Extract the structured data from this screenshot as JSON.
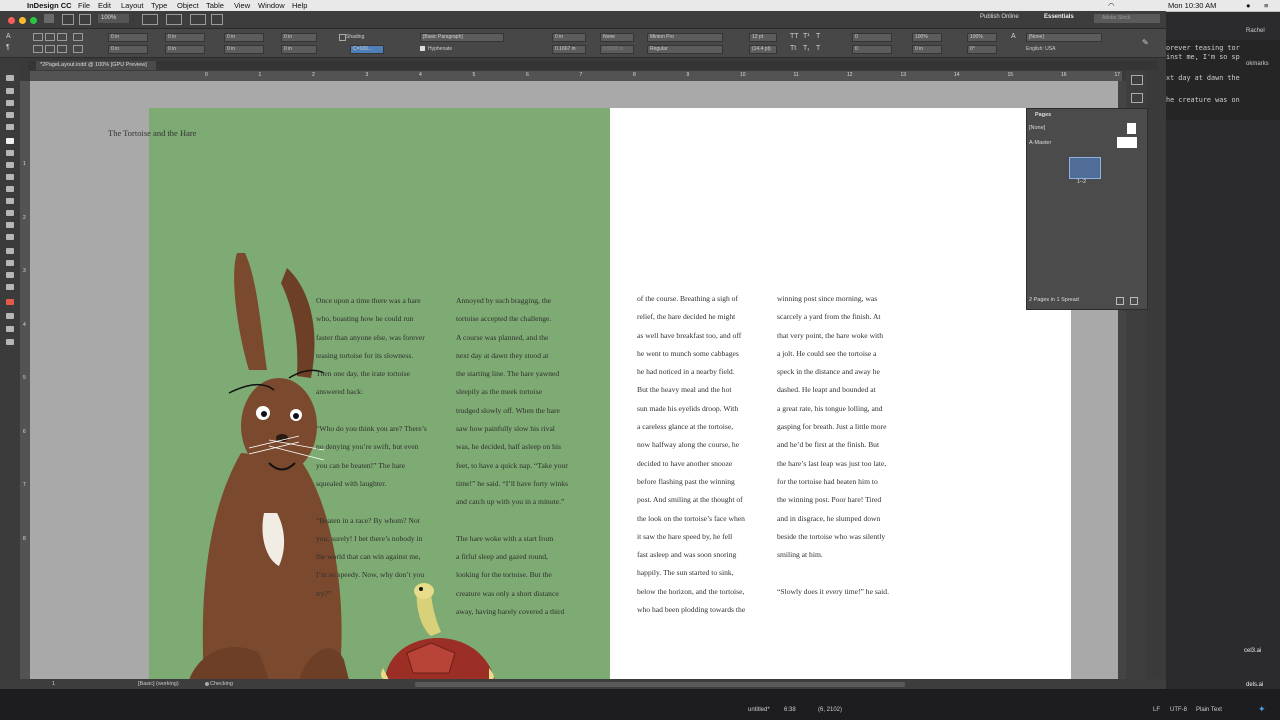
{
  "menubar": {
    "apple": "",
    "app_name": "InDesign CC",
    "items": [
      "File",
      "Edit",
      "Layout",
      "Type",
      "Object",
      "Table",
      "View",
      "Window",
      "Help"
    ],
    "clock": "Mon 10:30 AM",
    "user": "Rachel"
  },
  "titlebar": {
    "zoom": "100%",
    "publish": "Publish Online",
    "workspace": "Essentials",
    "search_placeholder": "Adobe Stock"
  },
  "control": {
    "fields_a": [
      "0 in",
      "0 in",
      "0 in",
      "0 in",
      "0 in",
      "0 in",
      "0 in",
      "0 in"
    ],
    "shading": "Shading",
    "shading_value": "C=100...",
    "para_style": "[Basic Paragraph]",
    "hyphenate": "Hyphenate",
    "none1": "None",
    "leading_a": "0.1667 in",
    "leading_b": "0.5833 in",
    "font": "Minion Pro",
    "style": "Regular",
    "size": "12 pt",
    "leading": "(14.4 pt)",
    "tracking": "0",
    "kerning": "0",
    "scale_h": "100%",
    "scale_v": "100%",
    "skew": "0°",
    "none2": "[None]",
    "language": "English: USA"
  },
  "document": {
    "tab": "*2PageLayout.indd @ 100% [GPU Preview]",
    "header_title": "The Tortoise and the Hare",
    "ruler_h": [
      "0",
      "1",
      "2",
      "3",
      "4",
      "5",
      "6",
      "7",
      "8",
      "9",
      "10",
      "11",
      "12",
      "13",
      "14",
      "15",
      "16",
      "17"
    ],
    "ruler_v": [
      "1",
      "2",
      "3",
      "4",
      "5",
      "6",
      "7",
      "8"
    ]
  },
  "story": {
    "col1": [
      "Once upon a time there was a hare",
      "who, boasting how he could run",
      "faster than anyone else, was forever",
      "teasing tortoise for its slowness.",
      "Then one day, the irate tortoise",
      "answered back:",
      "",
      "“Who do you think you are? There’s",
      "no denying you’re swift, but even",
      "you can be beaten!” The hare",
      "squealed with laughter.",
      "",
      "“Beaten in a race? By whom? Not",
      "you, surely! I bet there’s nobody in",
      "the world that can win against me,",
      "I’m so speedy. Now, why don’t you",
      "try?”"
    ],
    "col2": [
      "Annoyed by such bragging, the",
      "tortoise accepted the challenge.",
      "A course was planned, and the",
      "next day at dawn they stood at",
      "the starting line. The hare yawned",
      "sleepily as the meek tortoise",
      "trudged slowly off. When the hare",
      "saw how painfully slow his rival",
      "was, he decided, half asleep on his",
      "feet, to have a quick nap. “Take your",
      "time!” he said. “I’ll have forty winks",
      "and catch up with you in a minute.”",
      "",
      "The hare woke with a start from",
      "a fitful sleep and gazed round,",
      "looking for the tortoise. But the",
      "creature was only a short distance",
      "away, having barely covered a third"
    ],
    "col3": [
      "of the course. Breathing a sigh of",
      "relief, the hare decided he might",
      "as well have breakfast too, and off",
      "he went to munch some cabbages",
      "he had noticed in a nearby field.",
      "But the heavy meal and the hot",
      "sun made his eyelids droop. With",
      "a careless glance at the tortoise,",
      "now halfway along the course, he",
      "decided to have another snooze",
      "before flashing past the winning",
      "post. And smiling at the thought of",
      "the look on the tortoise’s face when",
      "it saw the hare speed by, he fell",
      "fast asleep and was soon snoring",
      "happily. The sun started to sink,",
      "below the horizon, and the tortoise,",
      "who had been plodding towards the"
    ],
    "col4": [
      "winning post since morning, was",
      "scarcely a yard from the finish. At",
      "that very point, the hare woke with",
      "a jolt. He could see the tortoise a",
      "speck in the distance and away he",
      "dashed. He leapt and bounded at",
      "a great rate, his tongue lolling, and",
      "gasping for breath. Just a little more",
      "and he’d be first at the finish. But",
      "the hare’s last leap was just too late,",
      "for the tortoise had beaten him to",
      "the winning post. Poor hare! Tired",
      "and in disgrace, he slumped down",
      "beside the tortoise who was silently",
      "smiling at him.",
      "",
      "“Slowly does it every time!” he said."
    ]
  },
  "pages_panel": {
    "title": "Pages",
    "none": "[None]",
    "master": "A-Master",
    "spread_label": "1–2",
    "footer": "2 Pages in 1 Spread"
  },
  "status": {
    "page": "1",
    "style": "[Basic] (working)",
    "preflight": "Checking"
  },
  "terminal": {
    "lines": [
      "orever teasing tor",
      "inst me, I'm so sp",
      "xt day at dawn the",
      "he creature was on"
    ],
    "side": [
      "Rachel",
      "okmarks"
    ]
  },
  "desktop": {
    "file": "untitled*",
    "pos": "6:38",
    "coords": "(6, 2102)",
    "lf": "LF",
    "enc": "UTF-8",
    "mode": "Plain Text",
    "files": [
      "cel3.ai",
      "dels.ai"
    ]
  },
  "colors": {
    "left_page": "#7eab73",
    "hare": "#7b4a2e",
    "tortoise_shell": "#9b2f25"
  }
}
